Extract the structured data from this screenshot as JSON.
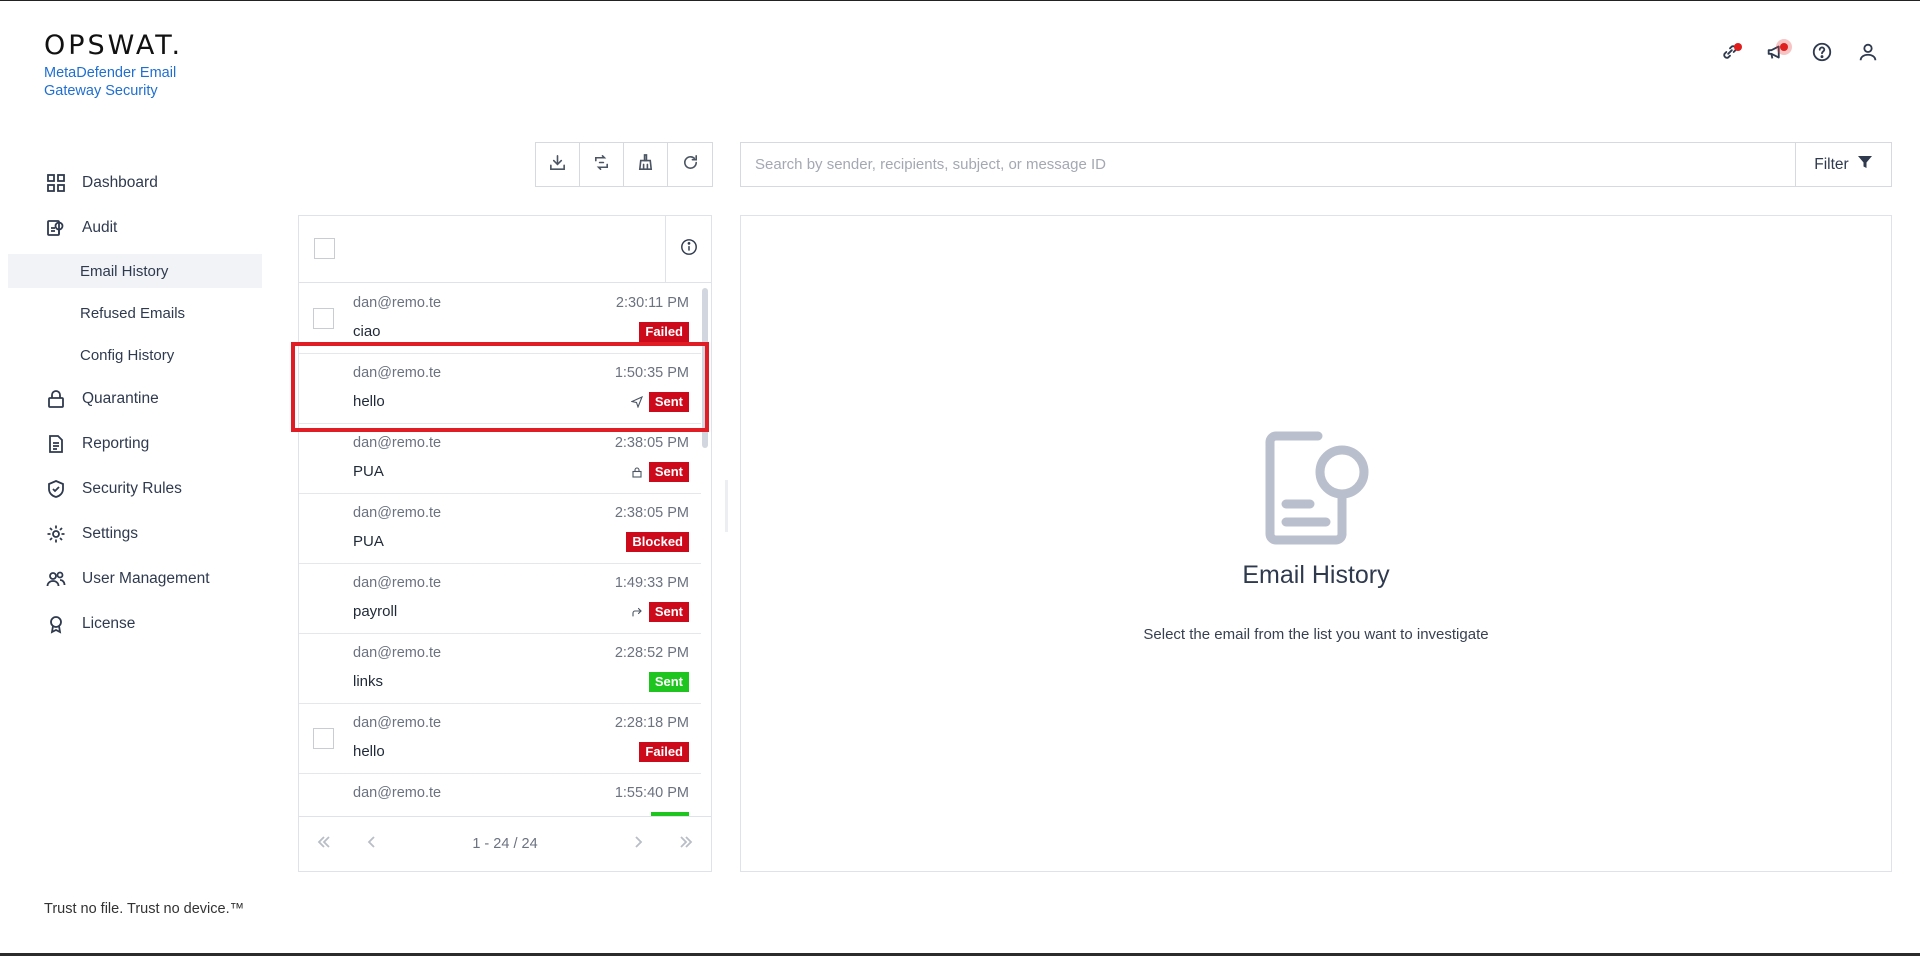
{
  "brand": {
    "logo": "OPSWAT.",
    "product": "MetaDefender Email Gateway Security"
  },
  "sidebar": {
    "items": [
      {
        "label": "Dashboard",
        "icon": "dashboard-icon"
      },
      {
        "label": "Audit",
        "icon": "audit-icon"
      },
      {
        "label": "Quarantine",
        "icon": "lock-icon"
      },
      {
        "label": "Reporting",
        "icon": "document-icon"
      },
      {
        "label": "Security Rules",
        "icon": "shield-check-icon"
      },
      {
        "label": "Settings",
        "icon": "gear-icon"
      },
      {
        "label": "User Management",
        "icon": "users-icon"
      },
      {
        "label": "License",
        "icon": "badge-icon"
      }
    ],
    "audit_sub": [
      "Email History",
      "Refused Emails",
      "Config History"
    ],
    "active": "Email History"
  },
  "footer": "Trust no file. Trust no device.™",
  "search": {
    "placeholder": "Search by sender, recipients, subject, or message ID",
    "filter_label": "Filter"
  },
  "list": {
    "rows": [
      {
        "sender": "dan@remo.te",
        "subject": "ciao",
        "time": "2:30:11 PM",
        "status": "Failed",
        "status_color": "#cc0a1c",
        "icon": "",
        "checkbox": true
      },
      {
        "sender": "dan@remo.te",
        "subject": "hello",
        "time": "1:50:35 PM",
        "status": "Sent",
        "status_color": "#cc0a1c",
        "icon": "send-icon",
        "checkbox": false
      },
      {
        "sender": "dan@remo.te",
        "subject": "PUA",
        "time": "2:38:05 PM",
        "status": "Sent",
        "status_color": "#cc0a1c",
        "icon": "lock-icon",
        "checkbox": false
      },
      {
        "sender": "dan@remo.te",
        "subject": "PUA",
        "time": "2:38:05 PM",
        "status": "Blocked",
        "status_color": "#cc0a1c",
        "icon": "",
        "checkbox": false
      },
      {
        "sender": "dan@remo.te",
        "subject": "payroll",
        "time": "1:49:33 PM",
        "status": "Sent",
        "status_color": "#cc0a1c",
        "icon": "forward-icon",
        "checkbox": false
      },
      {
        "sender": "dan@remo.te",
        "subject": "links",
        "time": "2:28:52 PM",
        "status": "Sent",
        "status_color": "#1fc51f",
        "icon": "",
        "checkbox": false
      },
      {
        "sender": "dan@remo.te",
        "subject": "hello",
        "time": "2:28:18 PM",
        "status": "Failed",
        "status_color": "#cc0a1c",
        "icon": "",
        "checkbox": true
      },
      {
        "sender": "dan@remo.te",
        "subject": "",
        "time": "1:55:40 PM",
        "status": "",
        "status_color": "#1fc51f",
        "icon": "",
        "checkbox": false
      }
    ],
    "pagination": "1 - 24 / 24"
  },
  "detail": {
    "title": "Email History",
    "description": "Select the email from the list you want to investigate"
  },
  "colors": {
    "accent": "#1f6fd1",
    "danger": "#cc0a1c",
    "success": "#1fc51f",
    "highlight": "#e01c25"
  }
}
